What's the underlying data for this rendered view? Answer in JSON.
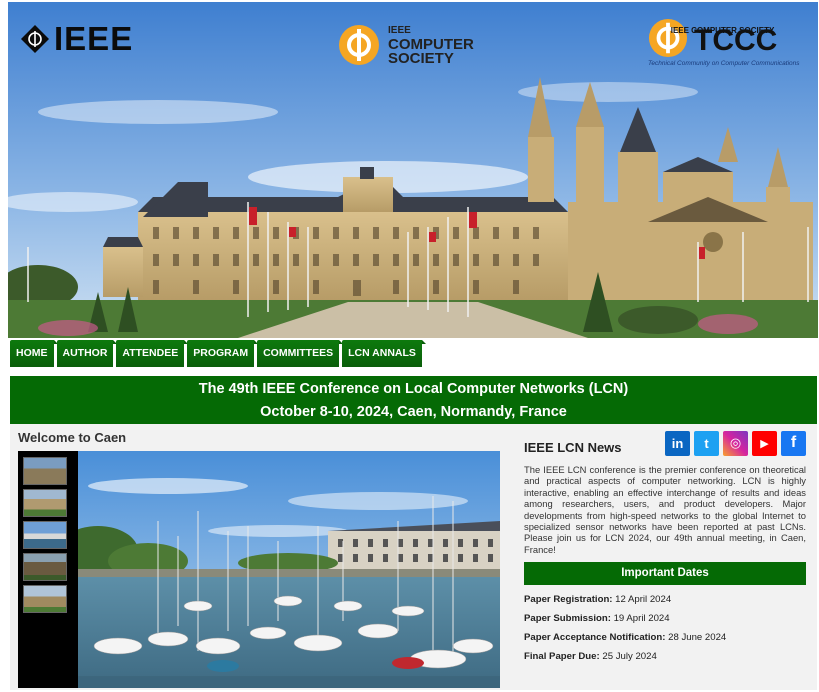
{
  "logos": {
    "ieee": "IEEE",
    "computer_society_line1": "IEEE",
    "computer_society_line2": "COMPUTER",
    "computer_society_line3": "SOCIETY",
    "tccc_society": "IEEE COMPUTER SOCIETY",
    "tccc": "TCCC",
    "tccc_sub": "Technical Community on Computer Communications"
  },
  "nav": [
    "HOME",
    "AUTHOR",
    "ATTENDEE",
    "PROGRAM",
    "COMMITTEES",
    "LCN ANNALS"
  ],
  "title": {
    "line1": "The 49th IEEE Conference on Local Computer Networks (LCN)",
    "line2": "October 8-10, 2024, Caen, Normandy, France"
  },
  "welcome": "Welcome to Caen",
  "news": {
    "title": "IEEE LCN News",
    "social_icons": [
      "linkedin-icon",
      "twitter-icon",
      "instagram-icon",
      "youtube-icon",
      "facebook-icon"
    ],
    "social_glyphs": [
      "in",
      "t",
      "◎",
      "▶",
      "f"
    ],
    "body": "The IEEE LCN conference is the premier conference on theoretical and practical aspects of computer networking. LCN is highly interactive, enabling an effective interchange of results and ideas among researchers, users, and product developers. Major developments from high-speed networks to the global Internet to specialized sensor networks have been reported at past LCNs. Please join us for LCN 2024, our 49th annual meeting, in Caen, France!"
  },
  "important_dates": {
    "title": "Important Dates",
    "items": [
      {
        "label": "Paper Registration:",
        "value": "12 April 2024"
      },
      {
        "label": "Paper Submission:",
        "value": "19 April 2024"
      },
      {
        "label": "Paper Acceptance Notification:",
        "value": "28 June 2024"
      },
      {
        "label": "Final Paper Due:",
        "value": "25 July 2024"
      }
    ]
  },
  "colors": {
    "nav_green": "#0a5e0a",
    "title_green": "#056a05",
    "linkedin": "#0a66c2",
    "twitter": "#1da1f2",
    "instagram": "#d6249f",
    "youtube": "#ff0000",
    "facebook": "#1877f2",
    "logo_orange": "#f5a623"
  }
}
